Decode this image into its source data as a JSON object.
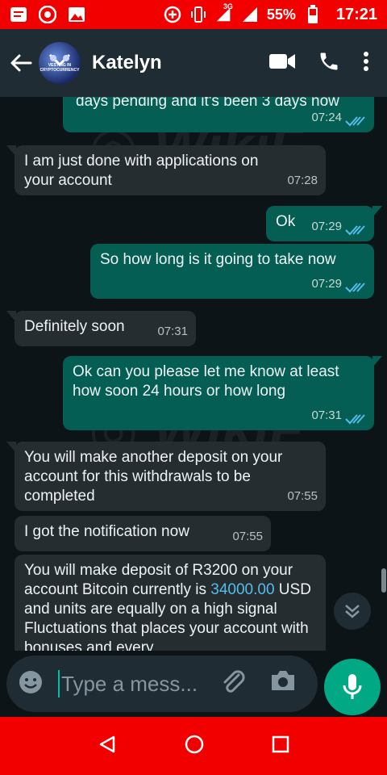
{
  "status_bar": {
    "network": "3G",
    "battery": "55%",
    "time": "17:21"
  },
  "header": {
    "contact_name": "Katelyn",
    "avatar_text": "VESTING IN CRYPTOCURRENCY"
  },
  "messages": [
    {
      "dir": "out",
      "text": "days pending and it's been 3 days now",
      "time": "07:24"
    },
    {
      "dir": "in",
      "text": "I am just done with applications on your account",
      "time": "07:28"
    },
    {
      "dir": "out",
      "text": "Ok",
      "time": "07:29"
    },
    {
      "dir": "out",
      "text": "So how long is it going to take now",
      "time": "07:29"
    },
    {
      "dir": "in",
      "text": "Definitely soon",
      "time": "07:31"
    },
    {
      "dir": "out",
      "text": "Ok can you please let me know at least how soon 24 hours or how long",
      "time": "07:31"
    },
    {
      "dir": "in",
      "text": "You will make another deposit on your account for this withdrawals to be completed",
      "time": "07:55"
    },
    {
      "dir": "in",
      "text": "I got the notification now",
      "time": "07:55"
    },
    {
      "dir": "in",
      "text_before": "You will make deposit of R3200 on your account Bitcoin currently is ",
      "link": "34000.00",
      "text_after": " USD and units are equally on a high signal Fluctuations that places your account with bonuses and every",
      "time": ""
    }
  ],
  "input": {
    "placeholder": "Type a mess..."
  },
  "colors": {
    "status_bar": "#f20000",
    "header": "#1f2c34",
    "background": "#0d1418",
    "incoming_bubble": "#262d31",
    "outgoing_bubble": "#055e54",
    "read_ticks": "#53bdeb",
    "mic_button": "#00a884"
  },
  "icons": {
    "back": "arrow-left-icon",
    "video": "video-camera-icon",
    "call": "phone-icon",
    "menu": "more-vert-icon",
    "emoji": "emoji-icon",
    "attach": "paperclip-icon",
    "camera": "camera-icon",
    "mic": "microphone-icon",
    "scroll": "chevrons-down-icon"
  }
}
